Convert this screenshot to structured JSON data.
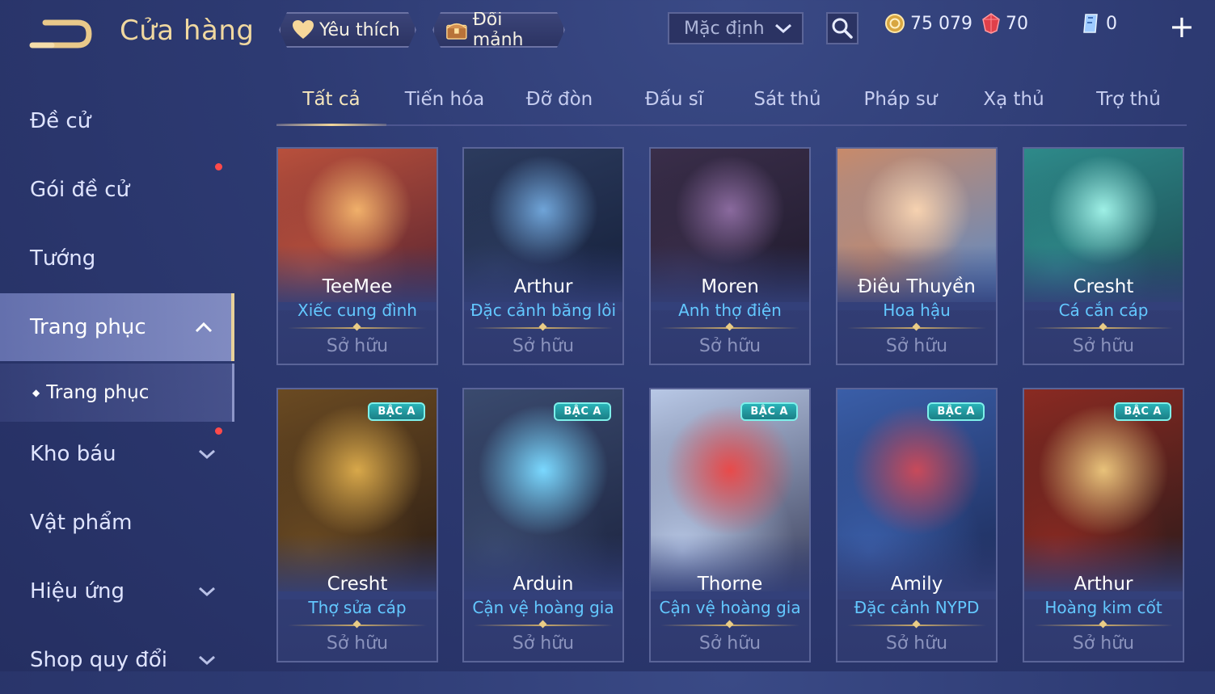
{
  "header": {
    "title": "Cửa hàng",
    "favorite_label": "Yêu thích",
    "shard_label": "Đổi mảnh",
    "sort_value": "Mặc định",
    "gold": "75 079",
    "ruby": "70",
    "voucher": "0"
  },
  "sidebar": {
    "items": [
      {
        "label": "Đề cử"
      },
      {
        "label": "Gói đề cử"
      },
      {
        "label": "Tướng"
      },
      {
        "label": "Trang phục"
      },
      {
        "label": "Trang phục"
      },
      {
        "label": "Kho báu"
      },
      {
        "label": "Vật phẩm"
      },
      {
        "label": "Hiệu ứng"
      },
      {
        "label": "Shop quy đổi"
      }
    ]
  },
  "tabs": [
    "Tất cả",
    "Tiến hóa",
    "Đỡ đòn",
    "Đấu sĩ",
    "Sát thủ",
    "Pháp sư",
    "Xạ thủ",
    "Trợ thủ"
  ],
  "cards": [
    {
      "name": "TeeMee",
      "skin": "Xiếc cung đình",
      "status": "Sở hữu",
      "badge": ""
    },
    {
      "name": "Arthur",
      "skin": "Đặc cảnh băng lôi",
      "status": "Sở hữu",
      "badge": ""
    },
    {
      "name": "Moren",
      "skin": "Anh thợ điện",
      "status": "Sở hữu",
      "badge": ""
    },
    {
      "name": "Điêu Thuyền",
      "skin": "Hoa hậu",
      "status": "Sở hữu",
      "badge": ""
    },
    {
      "name": "Cresht",
      "skin": "Cá cắn cáp",
      "status": "Sở hữu",
      "badge": ""
    },
    {
      "name": "Cresht",
      "skin": "Thợ sửa cáp",
      "status": "Sở hữu",
      "badge": "BẬC A"
    },
    {
      "name": "Arduin",
      "skin": "Cận vệ hoàng gia",
      "status": "Sở hữu",
      "badge": "BẬC A"
    },
    {
      "name": "Thorne",
      "skin": "Cận vệ hoàng gia",
      "status": "Sở hữu",
      "badge": "BẬC A"
    },
    {
      "name": "Amily",
      "skin": "Đặc cảnh NYPD",
      "status": "Sở hữu",
      "badge": "BẬC A"
    },
    {
      "name": "Arthur",
      "skin": "Hoàng kim cốt",
      "status": "Sở hữu",
      "badge": "BẬC A"
    }
  ],
  "colors": {
    "accent_gold": "#f0d8a0",
    "skin_name_blue": "#63c8ff",
    "badge_teal": "#2ab3b8",
    "notify_red": "#ff4a4a"
  },
  "icons": {
    "back": "back-arrow-icon",
    "favorite": "heart-icon",
    "shard": "chest-icon",
    "sort": "chevron-down-icon",
    "search": "search-icon",
    "gold": "gold-coin-icon",
    "ruby": "ruby-gem-icon",
    "voucher": "voucher-crystal-icon",
    "add": "plus-icon"
  }
}
